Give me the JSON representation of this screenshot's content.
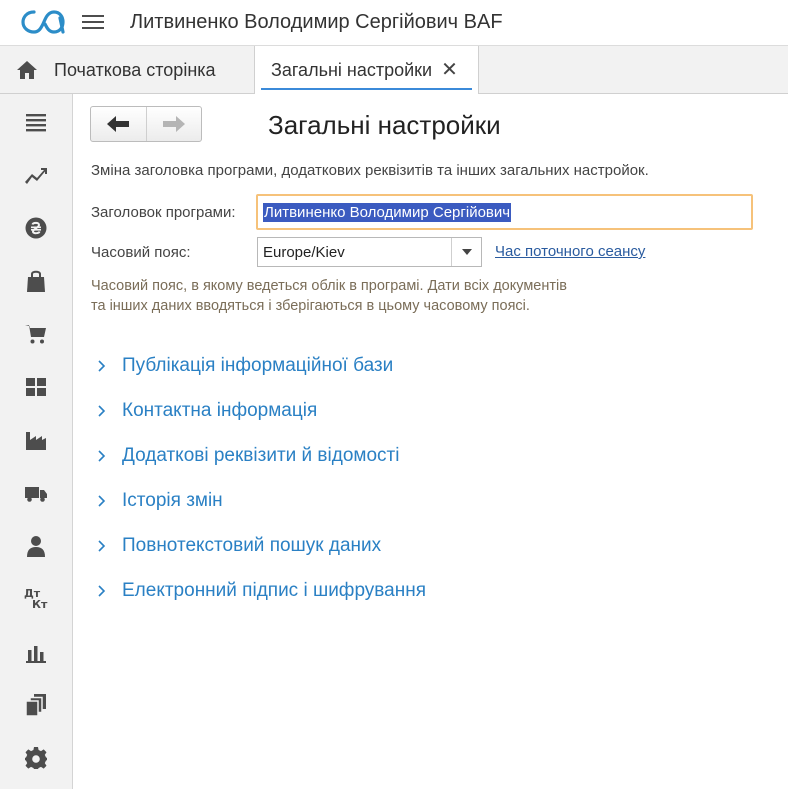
{
  "header": {
    "app_title": "Литвиненко Володимир Сергійович BAF"
  },
  "tabs": {
    "home_label": "Початкова сторінка",
    "active_label": "Загальні настройки",
    "close_glyph": "✕"
  },
  "sidebar": {
    "items": [
      {
        "icon": "menu-list-icon"
      },
      {
        "icon": "trend-chart-icon"
      },
      {
        "icon": "hryvnia-coin-icon"
      },
      {
        "icon": "shopping-bag-icon"
      },
      {
        "icon": "shopping-cart-icon"
      },
      {
        "icon": "warehouse-icon"
      },
      {
        "icon": "factory-icon"
      },
      {
        "icon": "delivery-truck-icon"
      },
      {
        "icon": "person-icon"
      },
      {
        "icon": "debit-credit-icon"
      },
      {
        "icon": "bar-chart-icon"
      },
      {
        "icon": "documents-icon"
      },
      {
        "icon": "settings-gear-icon"
      }
    ],
    "dtkt_top": "Дт",
    "dtkt_bottom": "Кт"
  },
  "main": {
    "title": "Загальні настройки",
    "description": "Зміна заголовка програми, додаткових реквізитів та інших загальних настройок.",
    "app_title_label": "Заголовок програми:",
    "app_title_value": "Литвиненко Володимир Сергійович",
    "timezone_label": "Часовий пояс:",
    "timezone_value": "Europe/Kiev",
    "session_time_link": "Час поточного сеансу",
    "timezone_hint": "Часовий пояс, в якому ведеться облік в програмі. Дати всіх документів та інших даних вводяться і зберігаються в цьому часовому поясі.",
    "sections": [
      "Публікація інформаційної бази",
      "Контактна інформація",
      "Додаткові реквізити й відомості",
      "Історія змін",
      "Повнотекстовий пошук даних",
      "Електронний підпис і шифрування"
    ]
  },
  "colors": {
    "accent": "#3b8ad9",
    "section_link": "#2a80c4",
    "input_focus_border": "#f6c27a",
    "selection": "#3b5bc0",
    "hint_text": "#7a6d58"
  }
}
